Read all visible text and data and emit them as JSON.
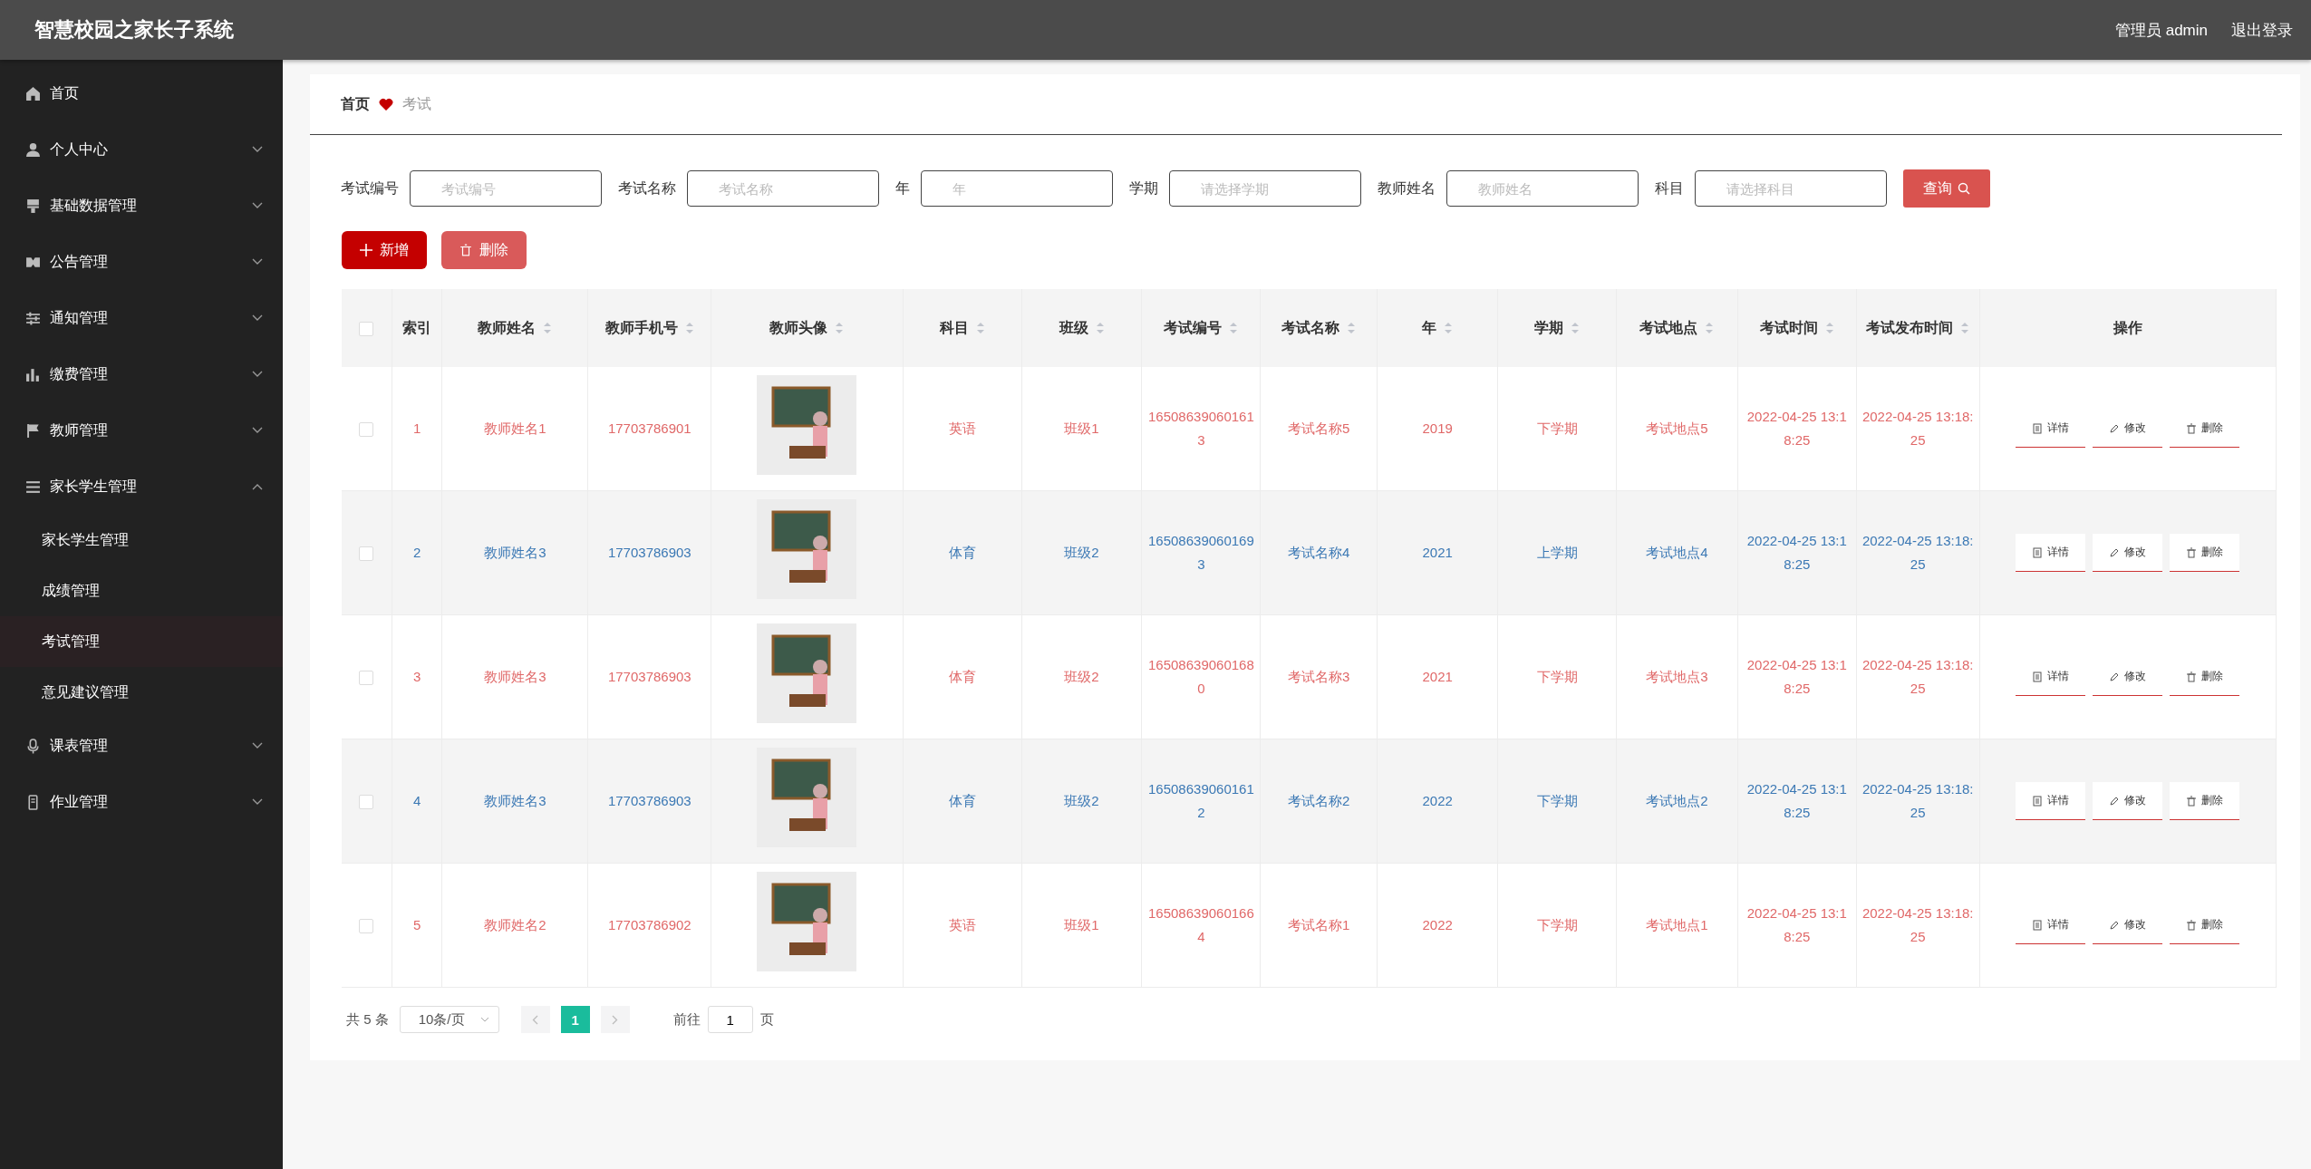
{
  "header": {
    "title": "智慧校园之家长子系统",
    "user": "管理员 admin",
    "logout": "退出登录"
  },
  "sidebar": {
    "items": [
      {
        "kind": "link",
        "label": "首页"
      },
      {
        "kind": "menu",
        "label": "个人中心",
        "expanded": false
      },
      {
        "kind": "menu",
        "label": "基础数据管理",
        "expanded": false
      },
      {
        "kind": "menu",
        "label": "公告管理",
        "expanded": false
      },
      {
        "kind": "menu",
        "label": "通知管理",
        "expanded": false
      },
      {
        "kind": "menu",
        "label": "缴费管理",
        "expanded": false
      },
      {
        "kind": "menu",
        "label": "教师管理",
        "expanded": false
      },
      {
        "kind": "menu",
        "label": "家长学生管理",
        "expanded": true,
        "children": [
          {
            "label": "家长学生管理",
            "selected": false
          },
          {
            "label": "成绩管理",
            "selected": false
          },
          {
            "label": "考试管理",
            "selected": true
          },
          {
            "label": "意见建议管理",
            "selected": false
          }
        ]
      },
      {
        "kind": "menu",
        "label": "课表管理",
        "expanded": false
      },
      {
        "kind": "menu",
        "label": "作业管理",
        "expanded": false
      }
    ]
  },
  "breadcrumb": [
    "首页",
    "考试"
  ],
  "filters": [
    {
      "label": "考试编号",
      "placeholder": "考试编号"
    },
    {
      "label": "考试名称",
      "placeholder": "考试名称"
    },
    {
      "label": "年",
      "placeholder": "年"
    },
    {
      "label": "学期",
      "placeholder": "请选择学期"
    },
    {
      "label": "教师姓名",
      "placeholder": "教师姓名"
    },
    {
      "label": "科目",
      "placeholder": "请选择科目"
    }
  ],
  "query_button": "查询",
  "toolbar": {
    "add": "新增",
    "delete": "删除"
  },
  "table": {
    "select_all_checked": false,
    "columns": [
      {
        "label": "索引",
        "sortable": false
      },
      {
        "label": "教师姓名",
        "sortable": true
      },
      {
        "label": "教师手机号",
        "sortable": true
      },
      {
        "label": "教师头像",
        "sortable": true
      },
      {
        "label": "科目",
        "sortable": true
      },
      {
        "label": "班级",
        "sortable": true
      },
      {
        "label": "考试编号",
        "sortable": true
      },
      {
        "label": "考试名称",
        "sortable": true
      },
      {
        "label": "年",
        "sortable": true
      },
      {
        "label": "学期",
        "sortable": true
      },
      {
        "label": "考试地点",
        "sortable": true
      },
      {
        "label": "考试时间",
        "sortable": true
      },
      {
        "label": "考试发布时间",
        "sortable": true
      },
      {
        "label": "操作",
        "sortable": false
      }
    ],
    "rows": [
      {
        "checked": false,
        "cells": [
          "1",
          "教师姓名1",
          "17703786901",
          null,
          "英语",
          "班级1",
          "165086390601613",
          "考试名称5",
          "2019",
          "下学期",
          "考试地点5",
          "2022-04-25 13:18:25",
          "2022-04-25 13:18:25"
        ],
        "actions": [
          "详情",
          "修改",
          "删除"
        ]
      },
      {
        "checked": false,
        "cells": [
          "2",
          "教师姓名3",
          "17703786903",
          null,
          "体育",
          "班级2",
          "165086390601693",
          "考试名称4",
          "2021",
          "上学期",
          "考试地点4",
          "2022-04-25 13:18:25",
          "2022-04-25 13:18:25"
        ],
        "actions": [
          "详情",
          "修改",
          "删除"
        ]
      },
      {
        "checked": false,
        "cells": [
          "3",
          "教师姓名3",
          "17703786903",
          null,
          "体育",
          "班级2",
          "165086390601680",
          "考试名称3",
          "2021",
          "下学期",
          "考试地点3",
          "2022-04-25 13:18:25",
          "2022-04-25 13:18:25"
        ],
        "actions": [
          "详情",
          "修改",
          "删除"
        ]
      },
      {
        "checked": false,
        "cells": [
          "4",
          "教师姓名3",
          "17703786903",
          null,
          "体育",
          "班级2",
          "165086390601612",
          "考试名称2",
          "2022",
          "下学期",
          "考试地点2",
          "2022-04-25 13:18:25",
          "2022-04-25 13:18:25"
        ],
        "actions": [
          "详情",
          "修改",
          "删除"
        ]
      },
      {
        "checked": false,
        "cells": [
          "5",
          "教师姓名2",
          "17703786902",
          null,
          "英语",
          "班级1",
          "165086390601664",
          "考试名称1",
          "2022",
          "下学期",
          "考试地点1",
          "2022-04-25 13:18:25",
          "2022-04-25 13:18:25"
        ],
        "actions": [
          "详情",
          "修改",
          "删除"
        ]
      }
    ]
  },
  "pagination": {
    "total": "共 5 条",
    "page_size": "10条/页",
    "pages": [
      {
        "label": "1",
        "selected": true
      }
    ],
    "goto_label": "前往",
    "goto_value": "1",
    "goto_suffix": "页"
  }
}
